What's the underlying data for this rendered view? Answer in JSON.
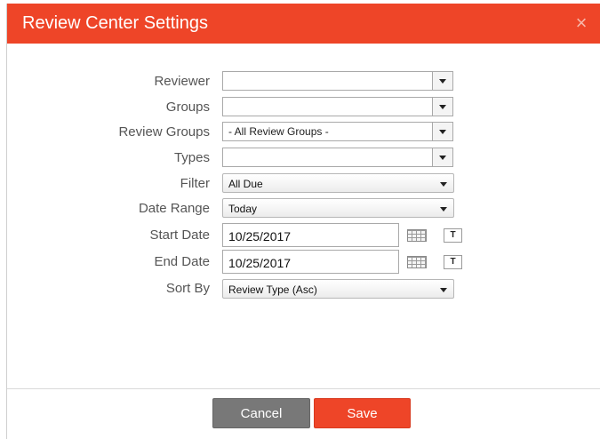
{
  "dialog": {
    "title": "Review Center Settings",
    "close_glyph": "×"
  },
  "form": {
    "reviewer_label": "Reviewer",
    "reviewer_value": "",
    "groups_label": "Groups",
    "groups_value": "",
    "review_groups_label": "Review Groups",
    "review_groups_value": "- All Review Groups -",
    "types_label": "Types",
    "types_value": "",
    "filter_label": "Filter",
    "filter_value": "All Due",
    "date_range_label": "Date Range",
    "date_range_value": "Today",
    "start_date_label": "Start Date",
    "start_date_value": "10/25/2017",
    "end_date_label": "End Date",
    "end_date_value": "10/25/2017",
    "sort_by_label": "Sort By",
    "sort_by_value": "Review Type (Asc)",
    "today_button": "T"
  },
  "footer": {
    "cancel_label": "Cancel",
    "save_label": "Save"
  },
  "colors": {
    "accent": "#ee4528",
    "cancel": "#787878"
  }
}
